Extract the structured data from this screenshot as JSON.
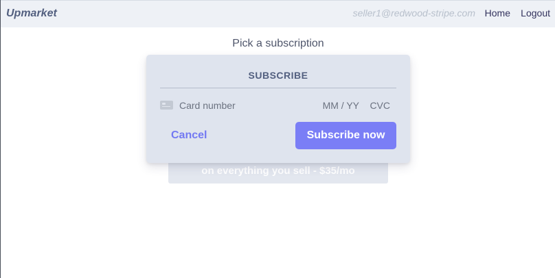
{
  "navbar": {
    "brand": "Upmarket",
    "email": "seller1@redwood-stripe.com",
    "home_label": "Home",
    "logout_label": "Logout"
  },
  "page": {
    "heading": "Pick a subscription"
  },
  "plan": {
    "text": "on everything you sell - ",
    "price": "$35/mo"
  },
  "modal": {
    "title": "SUBSCRIBE",
    "card_number_placeholder": "Card number",
    "expiry_placeholder": "MM / YY",
    "cvc_placeholder": "CVC",
    "card_icon": "credit-card-icon",
    "cancel_label": "Cancel",
    "subscribe_label": "Subscribe now"
  },
  "colors": {
    "accent": "#7a7ef6",
    "brand_text": "#525f7f",
    "navbar_bg": "#eef1f6",
    "modal_bg": "#dfe4ee"
  }
}
